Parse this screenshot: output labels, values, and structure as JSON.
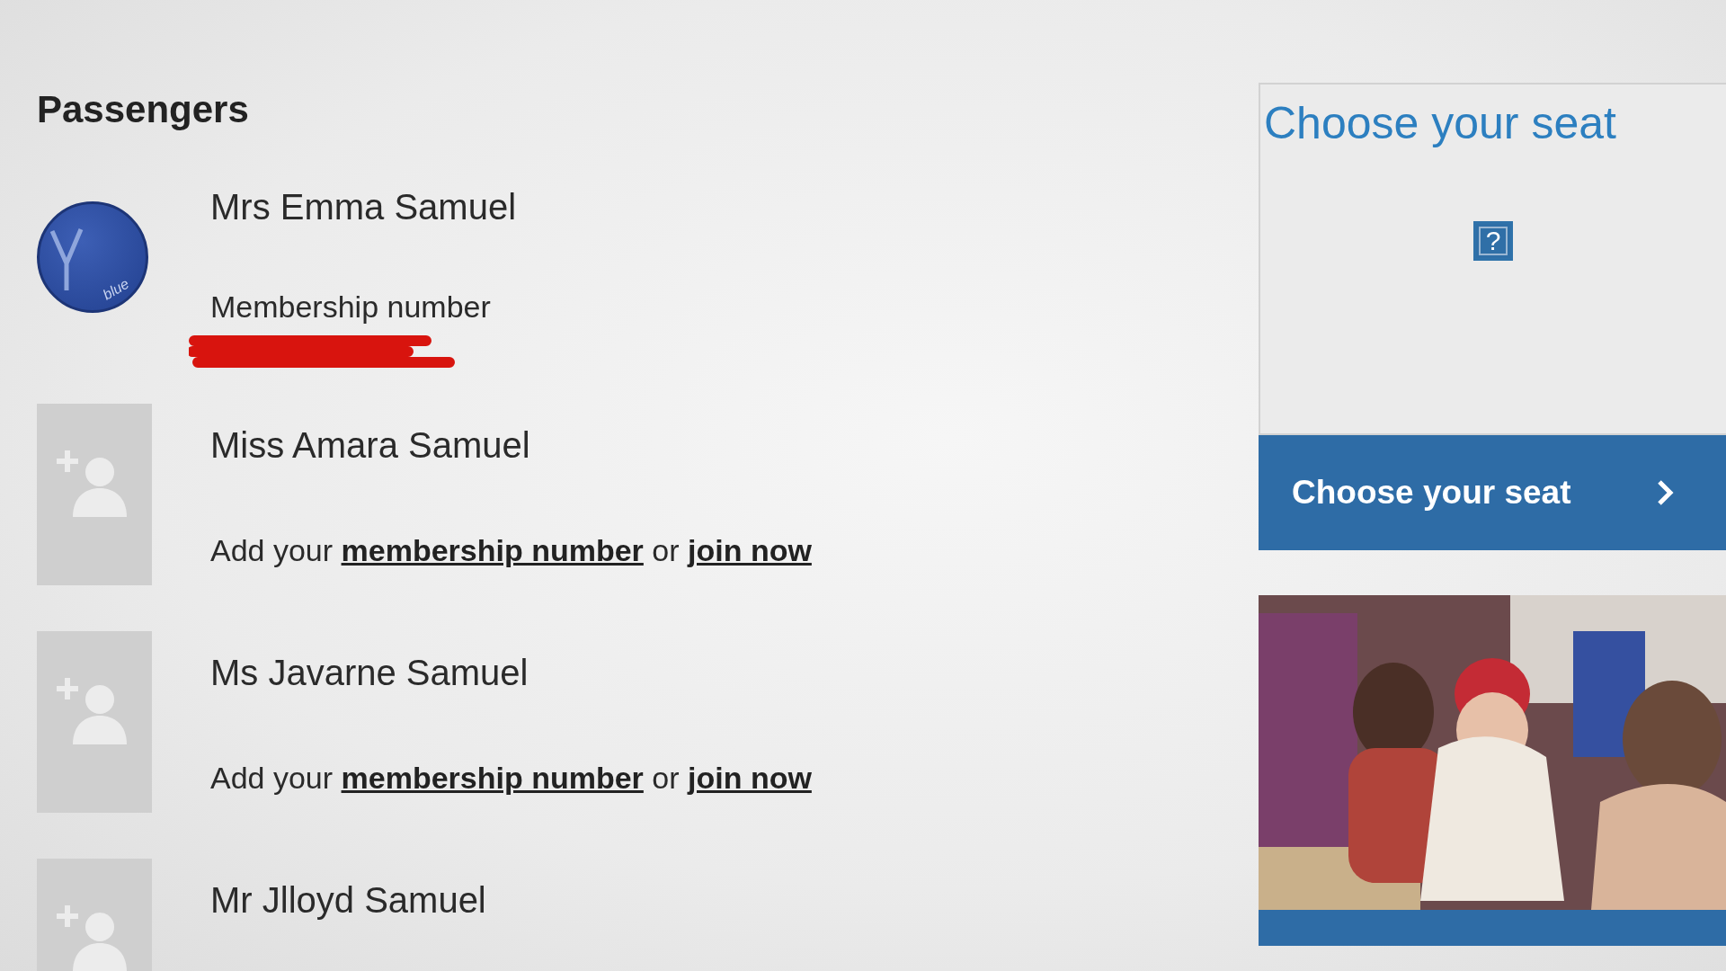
{
  "heading": "Passengers",
  "passengers": [
    {
      "name": "Mrs Emma Samuel",
      "kind": "member",
      "badge_text": "blue",
      "membership_label": "Membership number",
      "redacted": true
    },
    {
      "name": "Miss Amara Samuel",
      "kind": "guest",
      "add_text": "Add your",
      "membership_link": "membership number",
      "or_text": "or",
      "join_link": "join now"
    },
    {
      "name": "Ms Javarne Samuel",
      "kind": "guest",
      "add_text": "Add your",
      "membership_link": "membership number",
      "or_text": "or",
      "join_link": "join now"
    },
    {
      "name": "Mr Jlloyd Samuel",
      "kind": "guest"
    }
  ],
  "seat_card": {
    "title": "Choose your seat",
    "image_placeholder": "?",
    "button": "Choose your seat"
  }
}
